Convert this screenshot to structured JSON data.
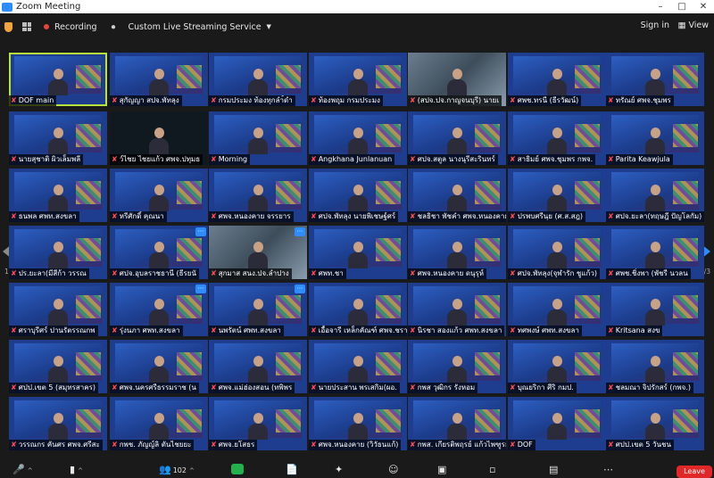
{
  "window": {
    "title": "Zoom Meeting"
  },
  "topbar": {
    "recording_label": "Recording",
    "streaming_label": "Custom Live Streaming Service",
    "signin_label": "Sign in",
    "view_label": "View"
  },
  "pagination": {
    "left": "1/3",
    "right": "1/3"
  },
  "participants": [
    "DOF main",
    "สุกัญญา สปจ.พัทลุง",
    "กรมประมง ท้องทุกลำ้ดำ",
    "ท้องพฤุม กรมประมง",
    "(สปจ.ปจ.กาญจนบุรี) นายเ",
    "ศพช.ทรนี (ธีรวัฒน์)",
    "ทรัณย์ ศพจ.ชุมพร",
    "นายสุชาติ ผิวเล็มพลี",
    "ว์ไชย ไชยแก้ว ศพจ.ปทุมธ",
    "Morning",
    "Angkhana Junlanuan",
    "ศปจ.สตูล นางนุรีสะรินทร์",
    "สาธิมย์ ศพจ.ชุมพร กพจ.",
    "Parita Keawjula",
    "ธนพล ศพท.สงขลา",
    "หรีศักดิ์ คุณนา",
    "ศพจ.หนองคาย จรรยาร",
    "ศปจ.พัทลุง นายพิเชษฐ์ศร์",
    "ชลธิชา พัชคำ ศพจ.หนองคาย",
    "ปรพบศรีนฺย (ศ.ส.สฎ)",
    "ศปจ.ยะลา(ทฤษฎี ปัญโลกัม)",
    "ปร.ยะลา(มีสีก้า วรรณ",
    "ศปจ.อุบลราชธานี (ธีรยนั",
    "สุกมาส สนง.ปจ.ลำปาง",
    "ศพท.ชา",
    "ศพจ.หนองคาย ดนุรุห์",
    "ศปจ.พัทลุง(จุฬารัก ชูแก้ว)",
    "ศพช.ชิ่งพา (พัชรี นวลน",
    "ศราบุรีศร์ ปานรัตรรณกพ",
    "รุ่งนภา ศพท.สงขลา",
    "นพรัตน์ ศพท.สงขลา",
    "เอื้อจารี เหล็กคัณฑ์ ศพจ.ชรา",
    "นิรชา สองแก้ว ศพท.สงขลา",
    "ทศพงษ์ ศพท.สงขลา",
    "Kritsana สงข",
    "ศปป.เขต 5 (สมุทรสาคร)",
    "ศพจ.นครศรีธรรมราช (น",
    "ศพจ.แม่ฮ่องสอน (ทพิพร",
    "นายประสาน พรเสกิม(ผอ.",
    "กพส วุฒิกร รังหอม",
    "บุณยริกา ศีริ กมป.",
    "ชลมณา จิปรักสร์ (กพจ.)",
    "วรรณกร คันศร ศพจ.ศรีสะ",
    "กพช. ภัญญ์ลิ ตันไชยยะ",
    "ศพจ.ยโสธร",
    "ศพจ.หนองคาย (วิวัธนแก้)",
    "กพส. เกียรติพฤรย์ แก้วไพฑูรย์",
    "DOF",
    "ศปป.เขต 5 วันชน"
  ],
  "bottombar": {
    "participants_count": "102",
    "leave_label": "Leave"
  }
}
